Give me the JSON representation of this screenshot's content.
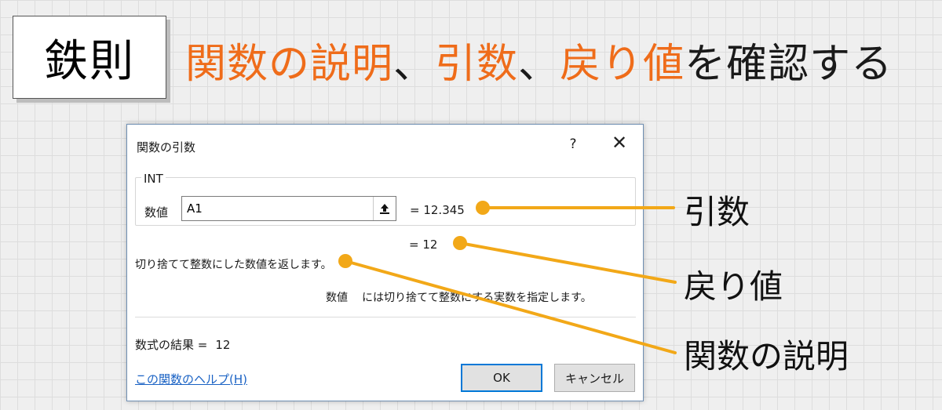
{
  "slide": {
    "rule_label": "鉄則",
    "headline": {
      "part1": "関数の説明",
      "sep1": "、",
      "part2": "引数",
      "sep2": "、",
      "part3": "戻り値",
      "part4": "を確認する"
    }
  },
  "dialog": {
    "title": "関数の引数",
    "help_glyph": "?",
    "close_glyph": "✕",
    "function_name": "INT",
    "argument": {
      "label": "数値",
      "value": "A1",
      "evaluated": "=  12.345"
    },
    "result_inline": "=  12",
    "description": "切り捨てて整数にした数値を返します。",
    "arg_description": {
      "name": "数値",
      "text": "には切り捨てて整数にする実数を指定します。"
    },
    "formula_result": {
      "label": "数式の結果 =",
      "value": "12"
    },
    "help_link": "この関数のヘルプ(H)",
    "ok_label": "OK",
    "cancel_label": "キャンセル"
  },
  "callouts": {
    "argument": "引数",
    "return_value": "戻り値",
    "description": "関数の説明"
  },
  "colors": {
    "accent_orange": "#ef6c1a",
    "callout_line": "#f2a818",
    "link_blue": "#1a62c4",
    "focus_blue": "#0078d7"
  }
}
